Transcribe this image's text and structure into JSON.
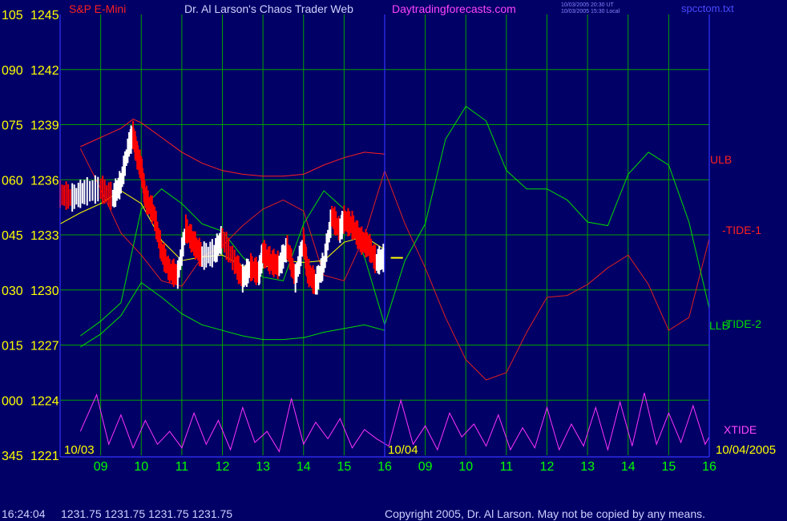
{
  "header": {
    "instrument": "S&P E-Mini",
    "title": "Dr. Al Larson's Chaos Trader Web",
    "website": "Daytradingforecasts.com",
    "timestamp_ut": "10/03/2005 20:30 UT",
    "timestamp_local": "10/03/2005 15:30 Local",
    "filename": "spcctom.txt"
  },
  "footer": {
    "time": "16:24:04",
    "ohlc": "1231.75 1231.75 1231.75 1231.75",
    "copyright": "Copyright 2005, Dr. Al Larson. May not be copied by any means."
  },
  "colors": {
    "background": "#000066",
    "grid": "#00a000",
    "axis": "#3333ff",
    "price_up": "#ffffff",
    "price_down": "#ff0000",
    "ulb_llb": "#ff2020",
    "tide1": "#e02020",
    "tide2": "#00dd00",
    "xtide": "#ff33ff",
    "yellow_label": "#ffff00",
    "title_text": "#d0d0ff",
    "website_text": "#ff44ff",
    "footer_text": "#cfcfff"
  },
  "chart_data": {
    "type": "line",
    "ylim": [
      1221,
      1245
    ],
    "y_ticks": [
      {
        "angle": "105",
        "price": "1245",
        "value": 1245
      },
      {
        "angle": "090",
        "price": "1242",
        "value": 1242
      },
      {
        "angle": "075",
        "price": "1239",
        "value": 1239
      },
      {
        "angle": "060",
        "price": "1236",
        "value": 1236
      },
      {
        "angle": "045",
        "price": "1233",
        "value": 1233
      },
      {
        "angle": "030",
        "price": "1230",
        "value": 1230
      },
      {
        "angle": "015",
        "price": "1227",
        "value": 1227
      },
      {
        "angle": "000",
        "price": "1224",
        "value": 1224
      },
      {
        "angle": "345",
        "price": "1221",
        "value": 1221
      }
    ],
    "x_ticks": [
      "09",
      "10",
      "11",
      "12",
      "13",
      "14",
      "15",
      "16",
      "09",
      "10",
      "11",
      "12",
      "13",
      "14",
      "15",
      "16"
    ],
    "date_labels": {
      "start": "10/03",
      "mid": "10/04",
      "end": "10/04/2005"
    },
    "series_labels": {
      "ulb": "ULB",
      "tide1": "-TIDE-1",
      "tide2": "-TIDE-2",
      "llb": "LLB",
      "xtide": "XTIDE"
    },
    "last_price": 1231.75,
    "series": [
      {
        "name": "ULB",
        "x": [
          8.5,
          9,
          9.5,
          9.8,
          10,
          10.5,
          11,
          11.5,
          12,
          12.5,
          13,
          13.5,
          14,
          14.5,
          15,
          15.5,
          16
        ],
        "values": [
          1237.8,
          1238.3,
          1238.8,
          1239.3,
          1239.1,
          1238.3,
          1237.5,
          1236.9,
          1236.5,
          1236.3,
          1236.2,
          1236.2,
          1236.3,
          1236.8,
          1237.2,
          1237.5,
          1237.4
        ]
      },
      {
        "name": "LLB",
        "x": [
          8.5,
          9,
          9.5,
          10,
          10.5,
          11,
          11.5,
          12,
          12.5,
          13,
          13.5,
          14,
          14.5,
          15,
          15.5,
          16
        ],
        "values": [
          1226.9,
          1227.6,
          1228.6,
          1230.4,
          1229.6,
          1228.7,
          1228.1,
          1227.8,
          1227.5,
          1227.3,
          1227.3,
          1227.4,
          1227.7,
          1227.9,
          1228.1,
          1227.8
        ]
      },
      {
        "name": "-TIDE-1",
        "x": [
          8.5,
          9,
          9.5,
          10,
          10.5,
          11,
          11.5,
          12,
          12.5,
          13,
          13.5,
          14,
          14.5,
          15,
          15.5,
          16,
          16.5,
          17,
          17.5,
          18,
          18.5,
          19,
          19.5,
          20,
          20.5,
          21,
          21.5,
          22,
          22.5,
          23,
          23.5,
          24
        ],
        "values": [
          1237.7,
          1235.5,
          1233.1,
          1231.9,
          1230.5,
          1230.2,
          1231.8,
          1232.4,
          1233.5,
          1234.4,
          1234.9,
          1234.3,
          1230.8,
          1230.5,
          1232.9,
          1236.5,
          1233.6,
          1231.2,
          1228.5,
          1226.2,
          1225.1,
          1225.5,
          1227.7,
          1229.6,
          1229.7,
          1230.3,
          1231.2,
          1231.9,
          1230.3,
          1227.8,
          1228.5,
          1232.8
        ]
      },
      {
        "name": "-TIDE-2",
        "x": [
          8.5,
          9,
          9.5,
          10,
          10.5,
          11,
          11.5,
          12,
          12.5,
          13,
          13.5,
          14,
          14.5,
          15,
          15.5,
          16,
          16.5,
          17,
          17.5,
          18,
          18.5,
          19,
          19.5,
          20,
          20.5,
          21,
          21.5,
          22,
          22.5,
          23,
          23.5,
          24
        ],
        "values": [
          1227.5,
          1228.3,
          1229.3,
          1234.4,
          1235.5,
          1234.7,
          1233.6,
          1233.2,
          1231.8,
          1230.7,
          1230.5,
          1233.6,
          1235.4,
          1234.4,
          1231.8,
          1228.1,
          1231.6,
          1233.6,
          1238.2,
          1240.0,
          1239.2,
          1236.5,
          1235.5,
          1235.5,
          1234.9,
          1233.7,
          1233.5,
          1236.3,
          1237.5,
          1236.8,
          1233.7,
          1229.0
        ]
      },
      {
        "name": "XTIDE",
        "x": [
          8.5,
          8.9,
          9.2,
          9.5,
          9.8,
          10.1,
          10.4,
          10.7,
          11,
          11.3,
          11.6,
          11.9,
          12.2,
          12.5,
          12.8,
          13.1,
          13.4,
          13.7,
          14,
          14.3,
          14.6,
          14.9,
          15.2,
          15.5,
          15.8,
          16.1,
          16.4,
          16.7,
          17,
          17.3,
          17.6,
          17.9,
          18.2,
          18.5,
          18.8,
          19.1,
          19.4,
          19.7,
          20,
          20.3,
          20.6,
          20.9,
          21.2,
          21.5,
          21.8,
          22.1,
          22.4,
          22.7,
          23,
          23.3,
          23.6,
          23.9,
          24
        ],
        "values": [
          1222.3,
          1224.3,
          1221.6,
          1223.2,
          1221.4,
          1222.9,
          1221.6,
          1222.3,
          1221.4,
          1223.3,
          1221.6,
          1222.9,
          1221.3,
          1223.6,
          1221.7,
          1222.3,
          1221.2,
          1224.1,
          1221.6,
          1222.8,
          1221.9,
          1223.0,
          1221.4,
          1222.4,
          1221.9,
          1221.5,
          1224.0,
          1221.6,
          1222.6,
          1221.3,
          1223.3,
          1222.0,
          1222.7,
          1221.5,
          1223.2,
          1221.3,
          1222.5,
          1221.4,
          1223.6,
          1221.3,
          1222.7,
          1221.5,
          1223.6,
          1221.3,
          1223.9,
          1221.5,
          1224.4,
          1221.6,
          1223.3,
          1221.7,
          1223.7,
          1221.6,
          1222.0
        ]
      },
      {
        "name": "price",
        "x": [
          8.0,
          8.3,
          8.6,
          9,
          9.3,
          9.5,
          9.7,
          9.8,
          9.9,
          10,
          10.1,
          10.3,
          10.5,
          10.7,
          10.9,
          11.1,
          11.3,
          11.5,
          11.8,
          12,
          12.3,
          12.5,
          12.7,
          12.9,
          13,
          13.2,
          13.4,
          13.6,
          13.8,
          14,
          14.1,
          14.3,
          14.5,
          14.7,
          14.9,
          15,
          15.2,
          15.4,
          15.6,
          15.8,
          16
        ],
        "values": [
          1235.2,
          1235.0,
          1235.3,
          1235.5,
          1235.0,
          1235.8,
          1237.9,
          1238.4,
          1237.3,
          1236.6,
          1235.0,
          1234.2,
          1232.1,
          1231.0,
          1230.8,
          1233.3,
          1232.5,
          1231.8,
          1232.0,
          1232.8,
          1231.5,
          1230.6,
          1231.2,
          1230.9,
          1232.0,
          1231.5,
          1231.3,
          1232.3,
          1230.6,
          1232.6,
          1231.0,
          1230.3,
          1231.4,
          1234.0,
          1233.2,
          1233.8,
          1233.5,
          1232.7,
          1232.4,
          1231.5,
          1231.75
        ]
      },
      {
        "name": "average",
        "x": [
          8.0,
          8.5,
          9,
          9.5,
          10,
          10.5,
          11,
          11.5,
          12,
          12.5,
          13,
          13.5,
          14,
          14.5,
          15,
          15.5,
          16
        ],
        "values": [
          1233.6,
          1234.2,
          1234.7,
          1235.4,
          1234.7,
          1232.7,
          1231.6,
          1231.8,
          1231.9,
          1231.3,
          1231.2,
          1231.6,
          1231.5,
          1231.6,
          1232.6,
          1232.9,
          1232.2
        ]
      }
    ]
  }
}
